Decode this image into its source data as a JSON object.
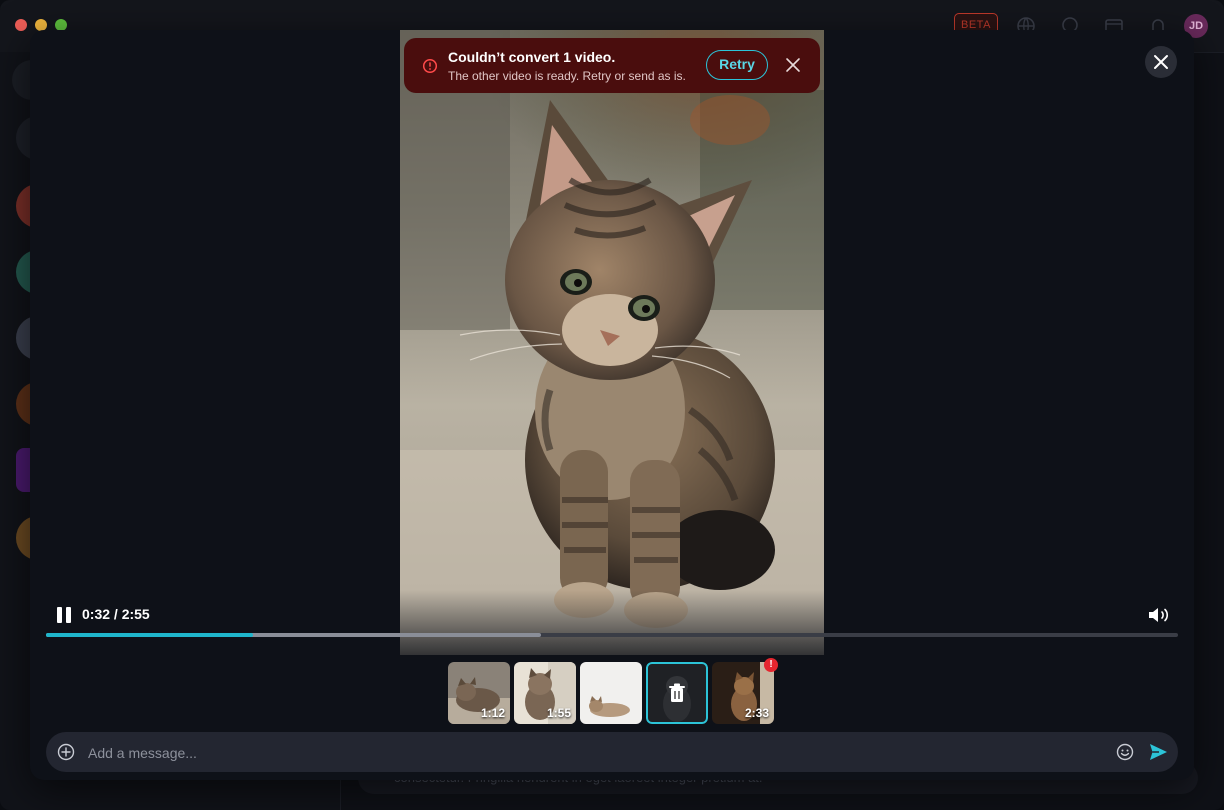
{
  "header": {
    "beta_label": "BETA",
    "user_initials": "JD"
  },
  "background_chat": {
    "composer_text": "consectetur. Fringilla hendrerit in eget laoreet integer pretium at."
  },
  "error_banner": {
    "title": "Couldn’t convert 1 video.",
    "message": "The other video is ready. Retry or send as is.",
    "retry_label": "Retry",
    "icon": "alert-circle-icon"
  },
  "player": {
    "time_display": "0:32 / 2:55",
    "current_time": "0:32",
    "duration": "2:55",
    "played_fraction": 0.183,
    "buffered_fraction": 0.437,
    "state": "playing"
  },
  "thumbnails": [
    {
      "duration": "1:12",
      "selected": false,
      "error": false
    },
    {
      "duration": "1:55",
      "selected": false,
      "error": false
    },
    {
      "duration": "",
      "selected": false,
      "error": false
    },
    {
      "duration": "",
      "selected": true,
      "error": false
    },
    {
      "duration": "2:33",
      "selected": false,
      "error": true,
      "badge": "!"
    }
  ],
  "composer": {
    "placeholder": "Add a message..."
  },
  "colors": {
    "accent": "#1fb6cc",
    "error_bg": "#4a0d0d",
    "error_badge": "#e5262f",
    "modal_bg": "#0e1118"
  }
}
